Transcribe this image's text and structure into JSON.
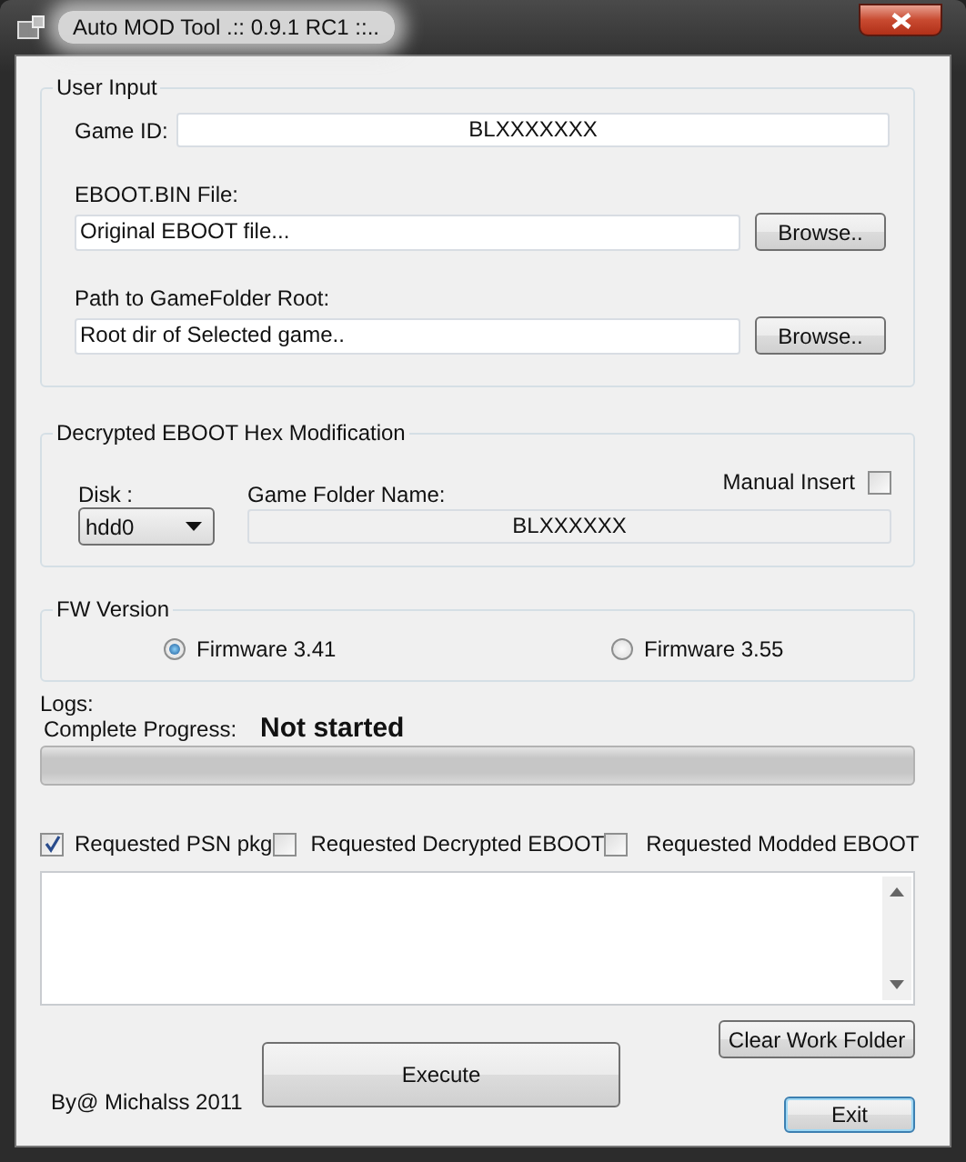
{
  "window": {
    "title": "Auto MOD Tool .:: 0.9.1 RC1 ::.."
  },
  "user_input": {
    "title": "User Input",
    "game_id": {
      "label": "Game ID:",
      "value": "BLXXXXXXX"
    },
    "eboot": {
      "label": "EBOOT.BIN File:",
      "value": "Original EBOOT file...",
      "button": "Browse.."
    },
    "game_folder": {
      "label": "Path to GameFolder Root:",
      "value": "Root dir of Selected game..",
      "button": "Browse.."
    }
  },
  "hex_mod": {
    "title": "Decrypted EBOOT Hex Modification",
    "disk": {
      "label": "Disk :",
      "value": "hdd0"
    },
    "folder_name": {
      "label": "Game Folder Name:",
      "value": "BLXXXXXX"
    },
    "manual_insert": {
      "label": "Manual Insert",
      "checked": false
    }
  },
  "fw_version": {
    "title": "FW Version",
    "options": [
      {
        "label": "Firmware 3.41",
        "selected": true
      },
      {
        "label": "Firmware 3.55",
        "selected": false
      }
    ]
  },
  "logs": {
    "label": "Logs:",
    "progress_label": "Complete Progress:",
    "status": "Not started",
    "level": 0
  },
  "requests": [
    {
      "label": "Requested PSN pkg",
      "checked": true
    },
    {
      "label": "Requested Decrypted EBOOT",
      "checked": false
    },
    {
      "label": "Requested Modded EBOOT",
      "checked": false
    }
  ],
  "buttons": {
    "clear": "Clear Work Folder",
    "execute": "Execute",
    "exit": "Exit"
  },
  "credit": "By@ Michalss 2011"
}
